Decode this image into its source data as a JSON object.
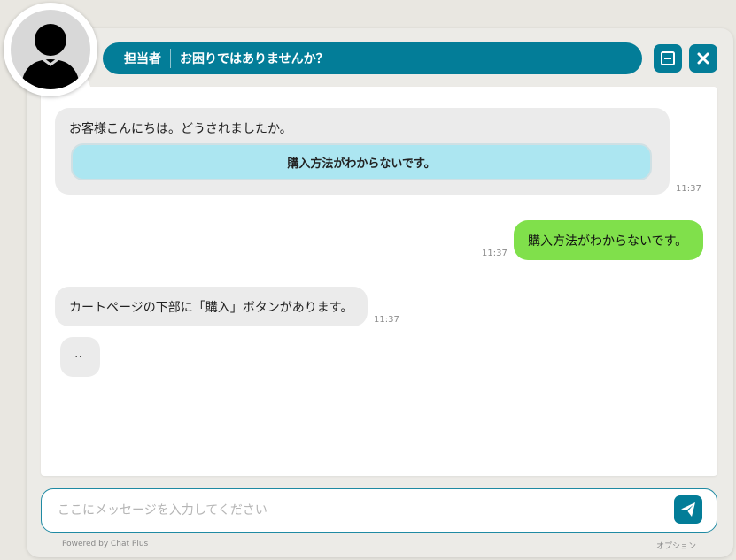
{
  "header": {
    "role": "担当者",
    "title": "お困りではありませんか？"
  },
  "controls": {
    "minimize_icon": "minimize-icon",
    "close_icon": "close-icon"
  },
  "messages": [
    {
      "from": "agent",
      "text": "お客様こんにちは。どうされましたか。",
      "choice": "購入方法がわからないです。",
      "time": "11:37"
    },
    {
      "from": "user",
      "text": "購入方法がわからないです。",
      "time": "11:37"
    },
    {
      "from": "agent",
      "text": "カートページの下部に「購入」ボタンがあります。",
      "time": "11:37"
    },
    {
      "from": "agent",
      "text": ".."
    }
  ],
  "input": {
    "placeholder": "ここにメッセージを入力してください",
    "value": ""
  },
  "footer": {
    "powered_by": "Powered by Chat Plus",
    "options": "オプション"
  },
  "colors": {
    "brand": "#037d98",
    "agent_bubble": "#ebebeb",
    "user_bubble": "#80e04b",
    "choice_button": "#ace6f1"
  }
}
